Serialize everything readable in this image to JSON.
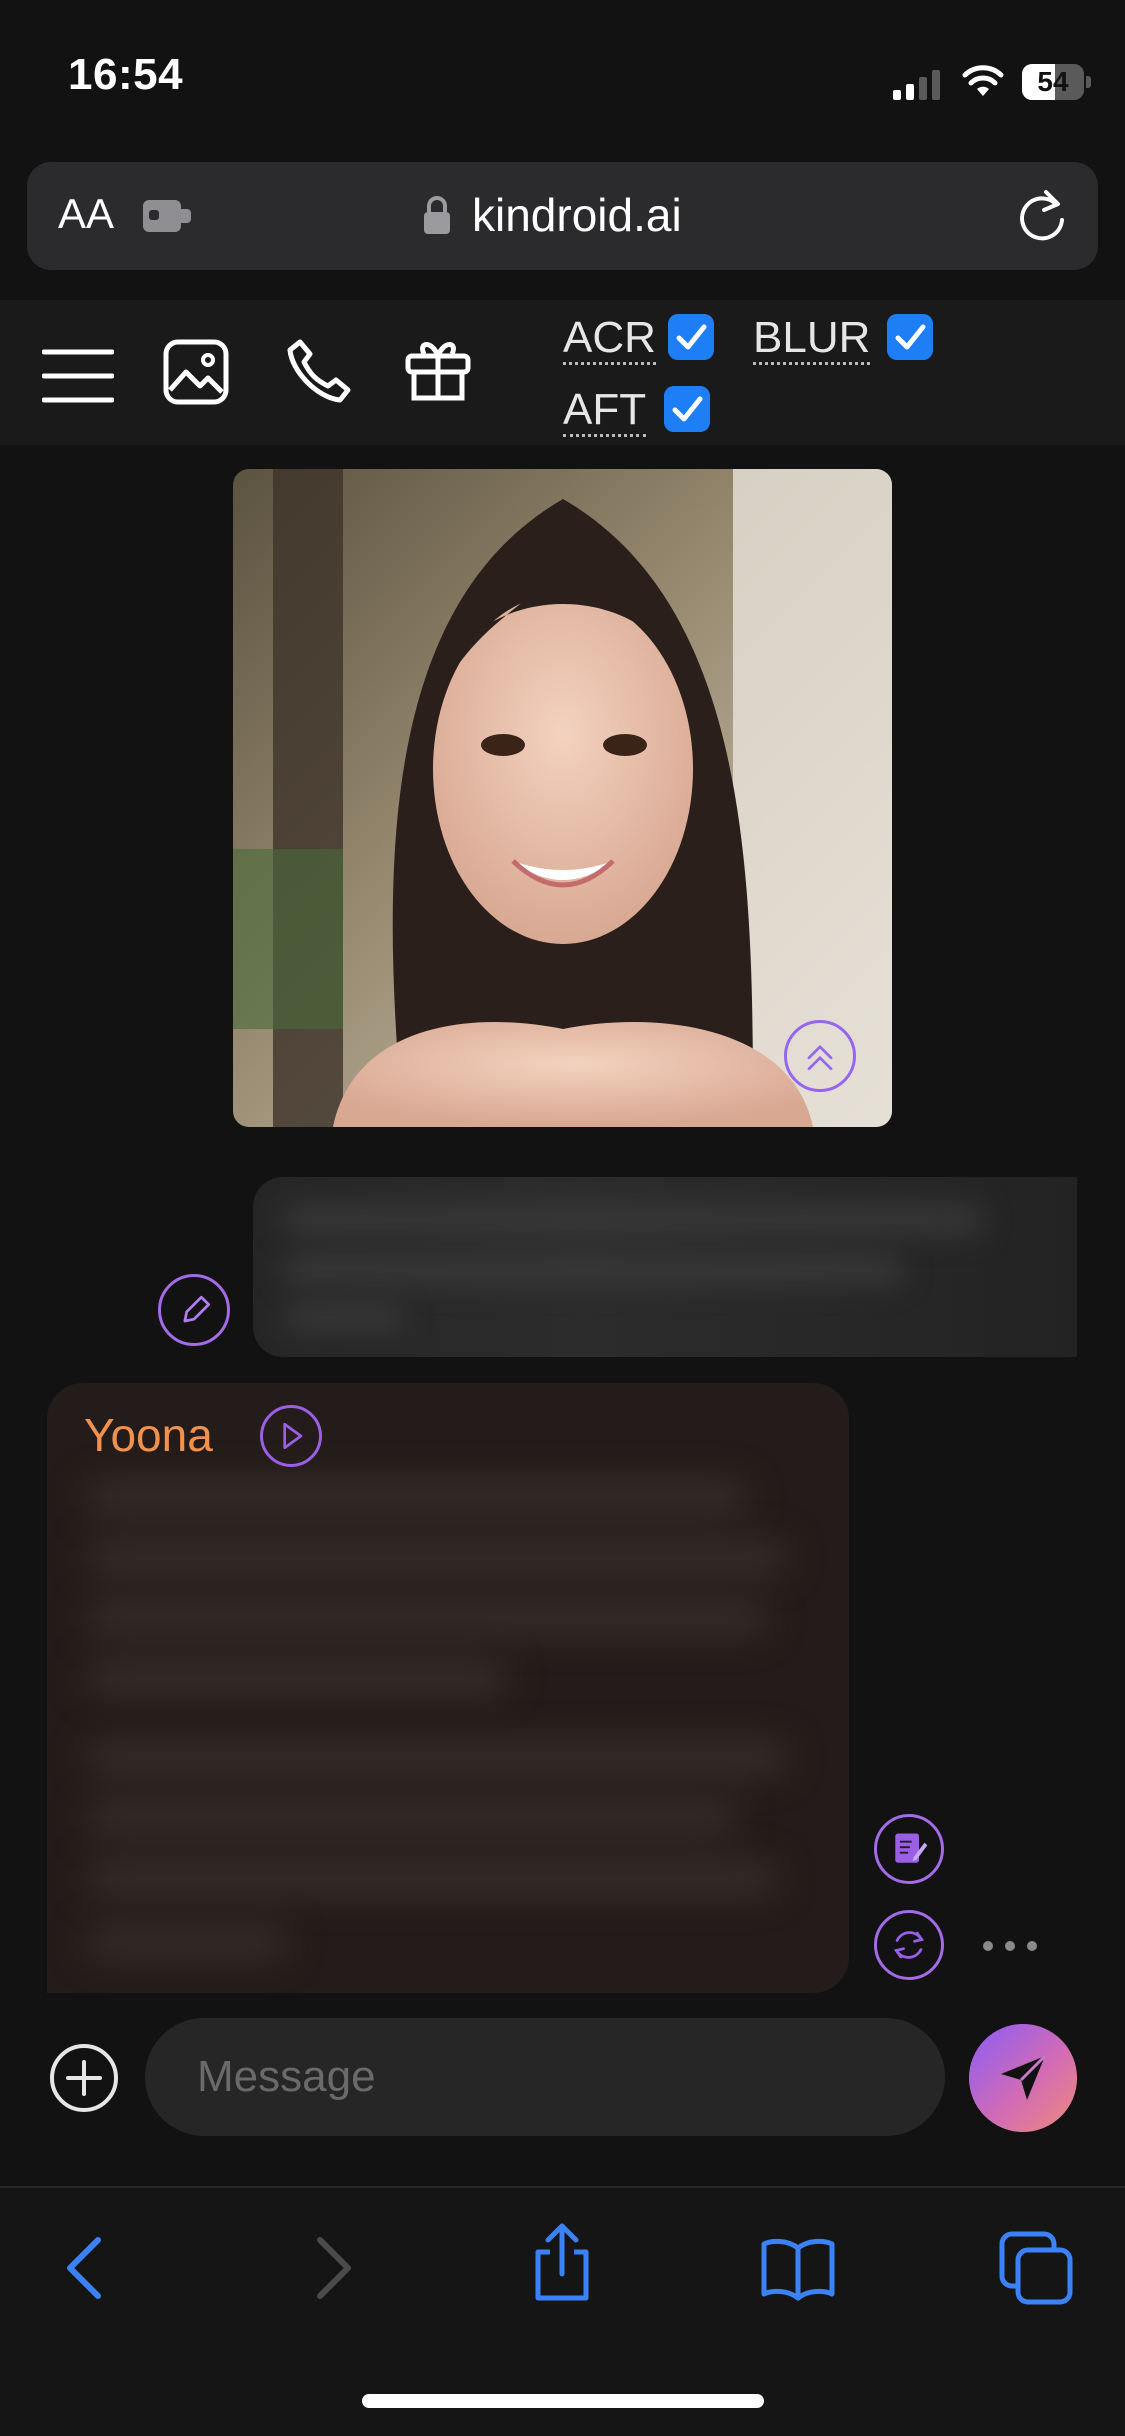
{
  "status_bar": {
    "time": "16:54",
    "battery": "54"
  },
  "browser": {
    "text_size_label": "AA",
    "url": "kindroid.ai"
  },
  "toolbar": {
    "options": [
      {
        "label": "ACR",
        "checked": true
      },
      {
        "label": "BLUR",
        "checked": true
      },
      {
        "label": "AFT",
        "checked": true
      }
    ]
  },
  "chat": {
    "ai_name": "Yoona"
  },
  "composer": {
    "placeholder": "Message"
  },
  "colors": {
    "accent_purple": "#9a5fe6",
    "name_orange": "#f0914e",
    "checkbox_blue": "#1d7ef5",
    "ios_blue": "#3b82f6"
  }
}
